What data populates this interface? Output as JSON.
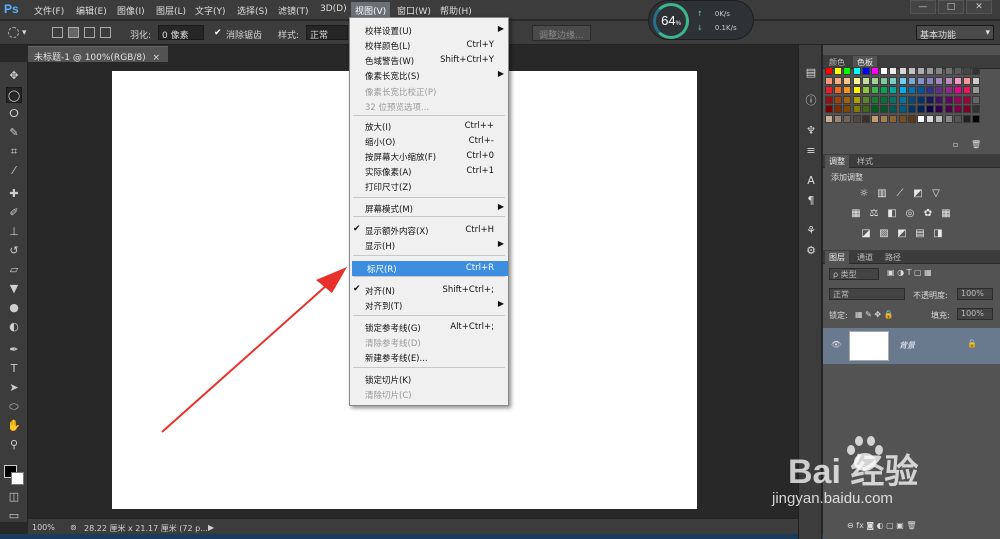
{
  "app": {
    "logo": "Ps"
  },
  "menubar": {
    "items": [
      "文件(F)",
      "编辑(E)",
      "图像(I)",
      "图层(L)",
      "文字(Y)",
      "选择(S)",
      "滤镜(T)",
      "3D(D)",
      "视图(V)",
      "窗口(W)",
      "帮助(H)"
    ],
    "active_index": 8,
    "window_buttons": [
      "—",
      "□",
      "✕"
    ]
  },
  "optbar": {
    "feather_label": "羽化:",
    "feather_value": "0 像素",
    "antialias_label": "消除锯齿",
    "antialias_checked": true,
    "style_label": "样式:",
    "style_value": "正常",
    "refine_edge_button": "调整边缘...",
    "workspace": "基本功能"
  },
  "speed_widget": {
    "percent": "64",
    "unit": "%",
    "up": "0K/s",
    "down": "0.1K/s"
  },
  "document": {
    "tab_title": "未标题-1 @ 100%(RGB/8)",
    "close": "×"
  },
  "statusbar": {
    "zoom": "100%",
    "info": "28.22 厘米 x 21.17 厘米 (72 p..."
  },
  "view_menu": {
    "items": [
      {
        "label": "校样设置(U)",
        "shortcut": "",
        "submenu": true,
        "disabled": false
      },
      {
        "label": "校样颜色(L)",
        "shortcut": "Ctrl+Y",
        "submenu": false,
        "disabled": false
      },
      {
        "label": "色域警告(W)",
        "shortcut": "Shift+Ctrl+Y",
        "submenu": false,
        "disabled": false
      },
      {
        "label": "像素长宽比(S)",
        "shortcut": "",
        "submenu": true,
        "disabled": false
      },
      {
        "label": "像素长宽比校正(P)",
        "shortcut": "",
        "submenu": false,
        "disabled": true
      },
      {
        "label": "32 位预览选项...",
        "shortcut": "",
        "submenu": false,
        "disabled": true
      },
      {
        "label": "放大(I)",
        "shortcut": "Ctrl++",
        "submenu": false,
        "disabled": false
      },
      {
        "label": "缩小(O)",
        "shortcut": "Ctrl+-",
        "submenu": false,
        "disabled": false
      },
      {
        "label": "按屏幕大小缩放(F)",
        "shortcut": "Ctrl+0",
        "submenu": false,
        "disabled": false
      },
      {
        "label": "实际像素(A)",
        "shortcut": "Ctrl+1",
        "submenu": false,
        "disabled": false
      },
      {
        "label": "打印尺寸(Z)",
        "shortcut": "",
        "submenu": false,
        "disabled": false
      },
      {
        "label": "屏幕模式(M)",
        "shortcut": "",
        "submenu": true,
        "disabled": false
      },
      {
        "label": "显示额外内容(X)",
        "shortcut": "Ctrl+H",
        "submenu": false,
        "disabled": false,
        "checked": true
      },
      {
        "label": "显示(H)",
        "shortcut": "",
        "submenu": true,
        "disabled": false
      },
      {
        "label": "标尺(R)",
        "shortcut": "Ctrl+R",
        "submenu": false,
        "disabled": false,
        "highlighted": true
      },
      {
        "label": "对齐(N)",
        "shortcut": "Shift+Ctrl+;",
        "submenu": false,
        "disabled": false,
        "checked": true
      },
      {
        "label": "对齐到(T)",
        "shortcut": "",
        "submenu": true,
        "disabled": false
      },
      {
        "label": "锁定参考线(G)",
        "shortcut": "Alt+Ctrl+;",
        "submenu": false,
        "disabled": false
      },
      {
        "label": "清除参考线(D)",
        "shortcut": "",
        "submenu": false,
        "disabled": true
      },
      {
        "label": "新建参考线(E)...",
        "shortcut": "",
        "submenu": false,
        "disabled": false
      },
      {
        "label": "锁定切片(K)",
        "shortcut": "",
        "submenu": false,
        "disabled": false
      },
      {
        "label": "清除切片(C)",
        "shortcut": "",
        "submenu": false,
        "disabled": true
      }
    ]
  },
  "panels": {
    "swatch_tabs": [
      "颜色",
      "色板"
    ],
    "adjust_tabs": [
      "调整",
      "样式"
    ],
    "adjust_title": "添加调整",
    "layer_tabs": [
      "图层",
      "通道",
      "路径"
    ],
    "layer_filter": "ρ 类型",
    "blend_mode": "正常",
    "opacity_label": "不透明度:",
    "opacity_value": "100%",
    "lock_label": "锁定:",
    "fill_label": "填充:",
    "fill_value": "100%",
    "layer_name": "背景"
  },
  "watermark": {
    "brand": "Bai 经验",
    "url": "jingyan.baidu.com"
  },
  "colors": {
    "highlight": "#3d8ee0",
    "arrow": "#e8312a",
    "ps_blue": "#5ab0ff"
  }
}
